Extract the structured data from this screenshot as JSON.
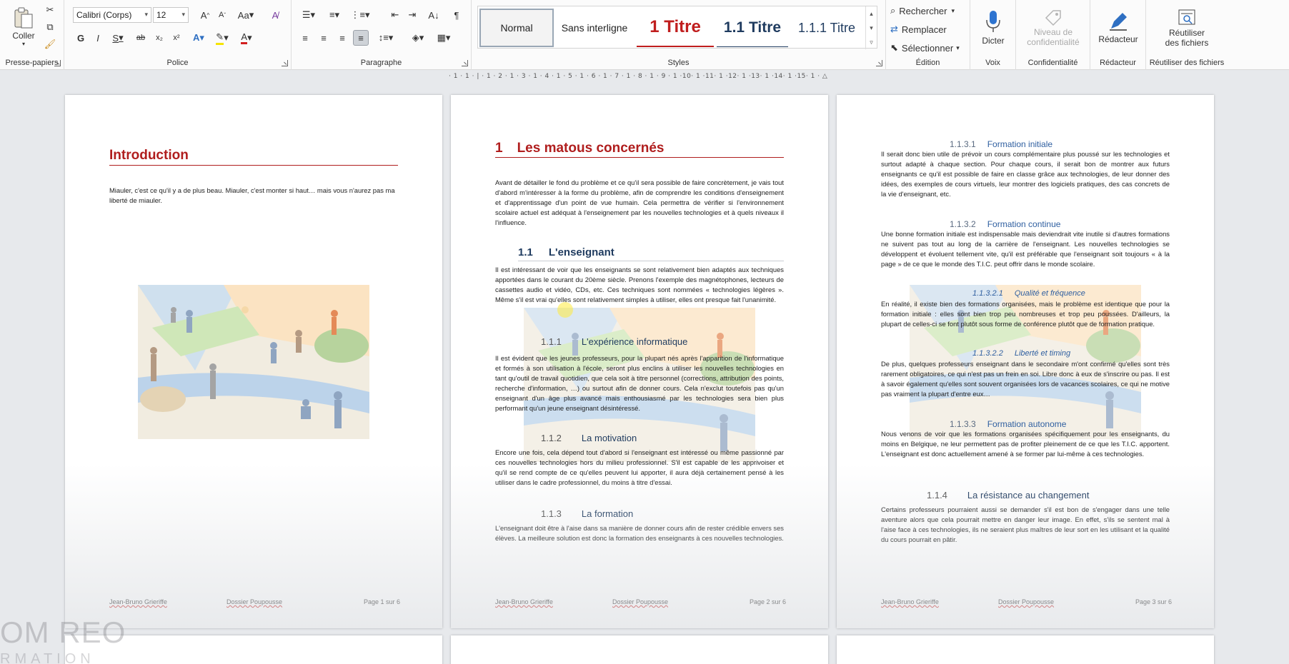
{
  "ribbon": {
    "clipboard": {
      "paste_label": "Coller",
      "group_label": "Presse-papiers"
    },
    "font": {
      "family": "Calibri (Corps)",
      "size": "12",
      "group_label": "Police",
      "bold": "G",
      "italic": "I",
      "underline": "S",
      "strike": "ab",
      "subscript": "x₂",
      "superscript": "x²",
      "case": "Aa"
    },
    "paragraph": {
      "group_label": "Paragraphe"
    },
    "styles": {
      "group_label": "Styles",
      "items": [
        {
          "label": "Normal"
        },
        {
          "label": "Sans interligne"
        },
        {
          "label": "1  Titre"
        },
        {
          "label": "1.1  Titre"
        },
        {
          "label": "1.1.1  Titre"
        }
      ]
    },
    "editing": {
      "group_label": "Édition",
      "find": "Rechercher",
      "replace": "Remplacer",
      "select": "Sélectionner"
    },
    "voice": {
      "group_label": "Voix",
      "dictate": "Dicter"
    },
    "sensitivity": {
      "group_label": "Confidentialité",
      "label_line1": "Niveau de",
      "label_line2": "confidentialité"
    },
    "editor": {
      "group_label": "Rédacteur",
      "label": "Rédacteur"
    },
    "reuse": {
      "group_label": "Réutiliser des fichiers",
      "label_line1": "Réutiliser",
      "label_line2": "des fichiers"
    }
  },
  "ruler": {
    "text": "· 1 · 1 · | · 1 · 2 · 1 · 3 · 1 · 4 · 1 · 5 · 1 · 6 · 1 · 7 · 1 · 8 · 1 · 9 · 1 ·10· 1 ·11· 1 ·12· 1 ·13· 1 ·14· 1 ·15· 1 · △ · 1 · 17 · 1 · 18 ·"
  },
  "pages": {
    "p1": {
      "title": "Introduction",
      "body": "Miauler, c'est ce qu'il y a de plus beau. Miauler, c'est monter si haut… mais vous n'aurez pas ma liberté de miauler.",
      "footer": {
        "author": "Jean-Bruno Grieriffe",
        "doc": "Dossier Poupousse",
        "page": "Page 1 sur 6"
      }
    },
    "p2": {
      "h1_num": "1",
      "h1_title": "Les matous concernés",
      "intro": "Avant de détailler le fond du problème et ce qu'il sera possible de faire concrètement, je vais tout d'abord m'intéresser à la forme du problème, afin de comprendre les conditions d'enseignement et d'apprentissage d'un point de vue humain. Cela permettra de vérifier si l'environnement scolaire actuel est adéquat à l'enseignement par les nouvelles technologies et à quels niveaux il l'influence.",
      "h2_num": "1.1",
      "h2_title": "L'enseignant",
      "s11": "Il est intéressant de voir que les enseignants se sont relativement bien adaptés aux techniques apportées dans le courant du 20ème siècle. Prenons l'exemple des magnétophones, lecteurs de cassettes audio et vidéo, CDs, etc. Ces techniques sont nommées « technologies légères ». Même s'il est vrai qu'elles sont relativement simples à utiliser, elles ont presque fait l'unanimité.",
      "h3a_num": "1.1.1",
      "h3a_title": "L'expérience informatique",
      "s111": "Il est évident que les jeunes professeurs, pour la plupart nés après l'apparition de l'informatique et formés à son utilisation à l'école, seront plus enclins à utiliser les nouvelles technologies en tant qu'outil de travail quotidien, que cela soit à titre personnel (corrections, attribution des points, recherche d'information, …) ou surtout afin de donner cours. Cela n'exclut toutefois pas qu'un enseignant d'un âge plus avancé mais enthousiasmé par les technologies sera bien plus performant qu'un jeune enseignant désintéressé.",
      "h3b_num": "1.1.2",
      "h3b_title": "La motivation",
      "s112": "Encore une fois, cela dépend tout d'abord si l'enseignant est intéressé ou même passionné par ces nouvelles technologies hors du milieu professionnel. S'il est capable de les apprivoiser et qu'il se rend compte de ce qu'elles peuvent lui apporter, il aura déjà certainement pensé à les utiliser dans le cadre professionnel, du moins à titre d'essai.",
      "h3c_num": "1.1.3",
      "h3c_title": "La formation",
      "s113": "L'enseignant doit être à l'aise dans sa manière de donner cours afin de rester crédible envers ses élèves. La meilleure solution est donc la formation des enseignants à ces nouvelles technologies.",
      "footer": {
        "author": "Jean-Bruno Grieriffe",
        "doc": "Dossier Poupousse",
        "page": "Page 2 sur 6"
      }
    },
    "p3": {
      "h4a_num": "1.1.3.1",
      "h4a_title": "Formation initiale",
      "s1131": "Il serait donc bien utile de prévoir un cours complémentaire plus poussé sur les technologies et surtout adapté à chaque section. Pour chaque cours, il serait bon de montrer aux futurs enseignants ce qu'il est possible de faire en classe grâce aux technologies, de leur donner des idées, des exemples de cours virtuels, leur montrer des logiciels pratiques, des cas concrets de la vie d'enseignant, etc.",
      "h4b_num": "1.1.3.2",
      "h4b_title": "Formation continue",
      "s1132": "Une bonne formation initiale est indispensable mais deviendrait vite inutile si d'autres formations ne suivent pas tout au long de la carrière de l'enseignant. Les nouvelles technologies se développent et évoluent tellement vite, qu'il est préférable que l'enseignant soit toujours « à la page » de ce que le monde des T.I.C. peut offrir dans le monde scolaire.",
      "h5a_num": "1.1.3.2.1",
      "h5a_title": "Qualité et fréquence",
      "s11321": "En réalité, il existe bien des formations organisées, mais le problème est identique que pour la formation initiale : elles sont bien trop peu nombreuses et trop peu poussées. D'ailleurs, la plupart de celles-ci se font plutôt sous forme de conférence plutôt que de formation pratique.",
      "h5b_num": "1.1.3.2.2",
      "h5b_title": "Liberté et timing",
      "s11322": "De plus, quelques professeurs enseignant dans le secondaire m'ont confirmé qu'elles sont très rarement obligatoires, ce qui n'est pas un frein en soi. Libre donc à eux de s'inscrire ou pas. Il est à savoir également qu'elles sont souvent organisées lors de vacances scolaires, ce qui ne motive pas vraiment la plupart d'entre eux…",
      "h4c_num": "1.1.3.3",
      "h4c_title": "Formation autonome",
      "s1133": "Nous venons de voir que les formations organisées spécifiquement pour les enseignants, du moins en Belgique, ne leur permettent pas de profiter pleinement de ce que les T.I.C. apportent. L'enseignant est donc actuellement amené à se former par lui-même à ces technologies.",
      "h3_num": "1.1.4",
      "h3_title": "La résistance au changement",
      "s114": "Certains professeurs pourraient aussi se demander s'il est bon de s'engager dans une telle aventure alors que cela pourrait mettre en danger leur image. En effet, s'ils se sentent mal à l'aise face à ces technologies, ils ne seraient plus maîtres de leur sort en les utilisant et la qualité du cours pourrait en pâtir.",
      "footer": {
        "author": "Jean-Bruno Grieriffe",
        "doc": "Dossier Poupousse",
        "page": "Page 3 sur 6"
      }
    }
  },
  "overlay": {
    "watermark_line1": "OM REO",
    "watermark_line2": "RMATION"
  }
}
